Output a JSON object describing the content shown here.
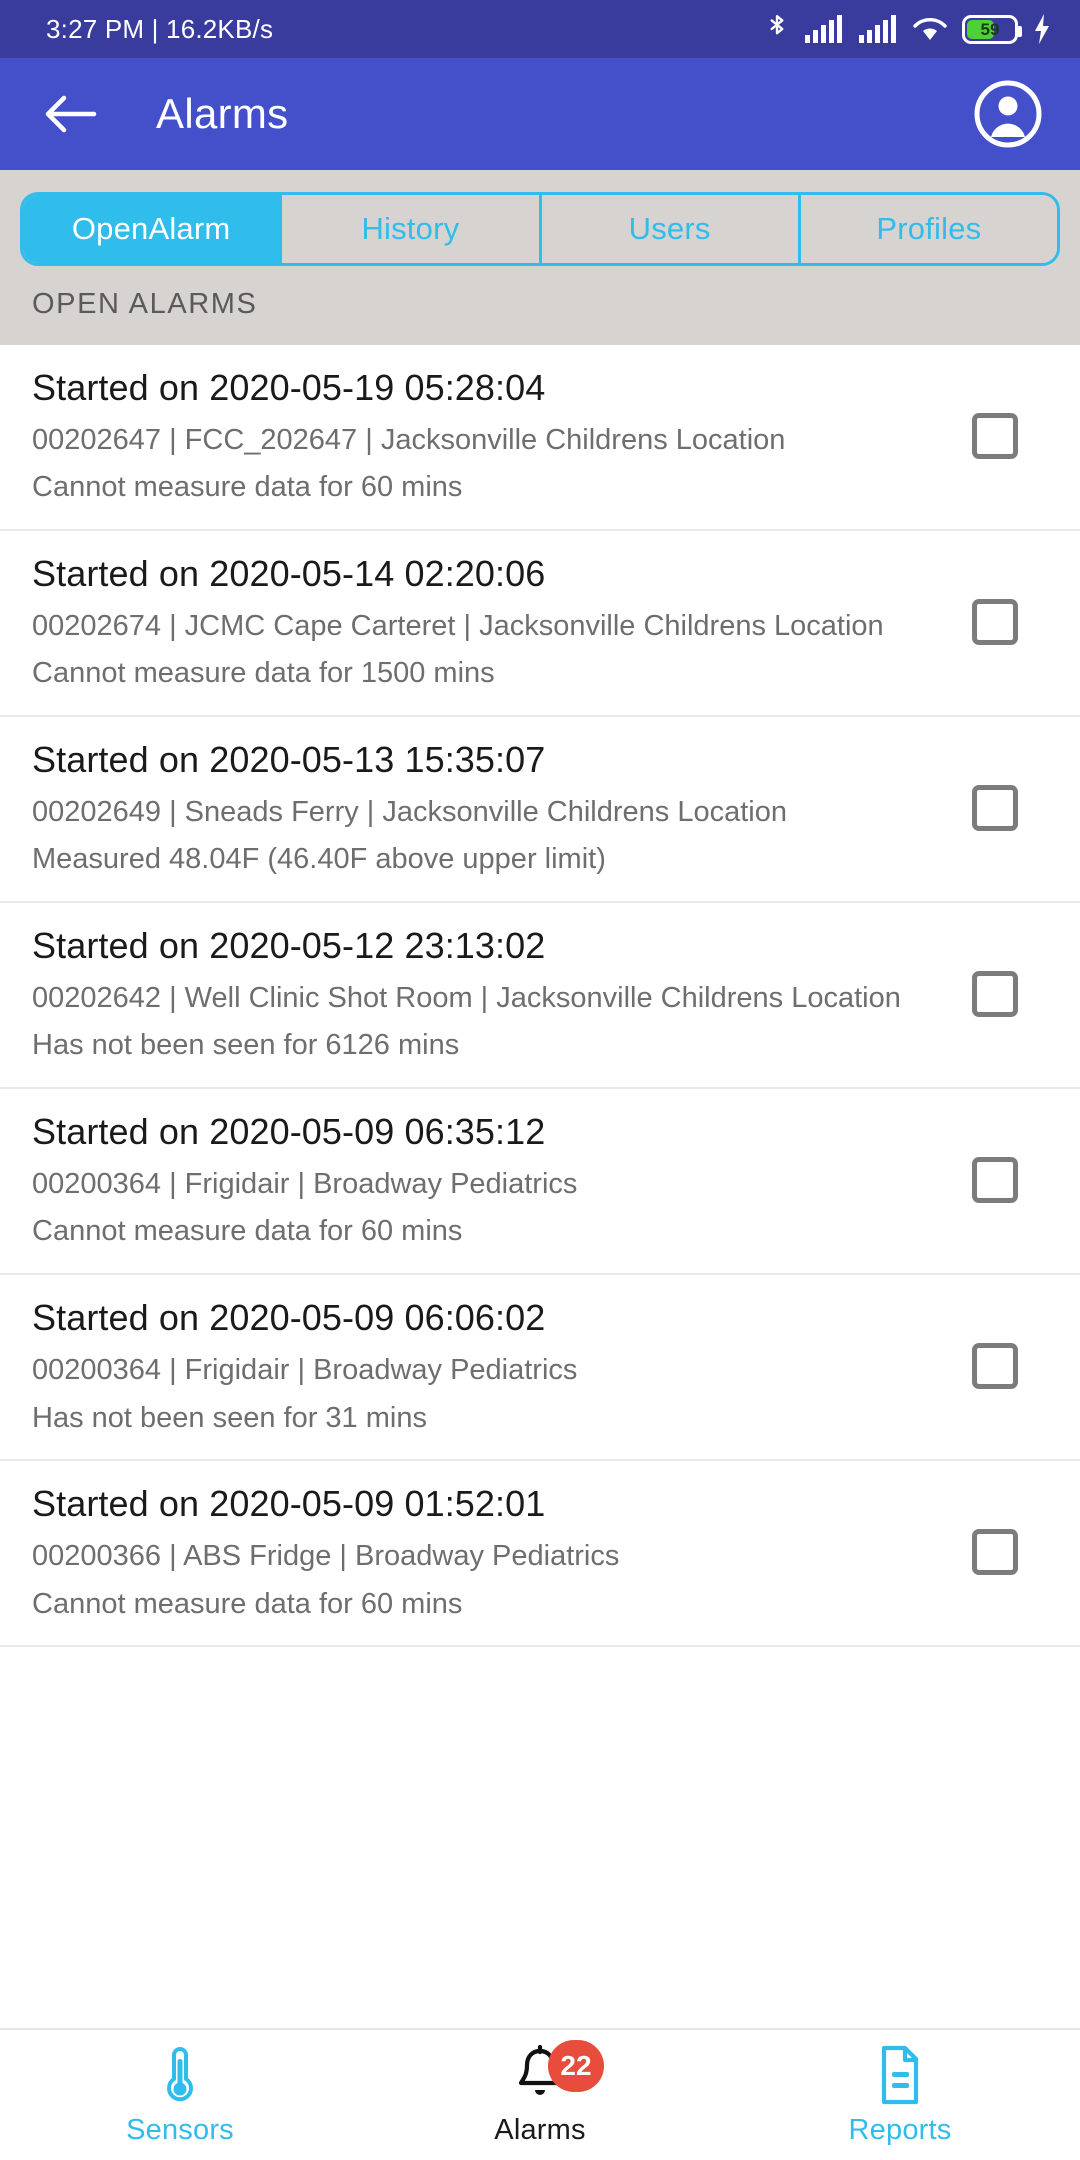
{
  "statusbar": {
    "time_and_speed": "3:27 PM | 16.2KB/s",
    "battery_percent": "59",
    "icons": [
      "bluetooth-icon",
      "signal-1-icon",
      "signal-2-icon",
      "wifi-icon",
      "battery-icon",
      "charging-bolt-icon"
    ]
  },
  "appbar": {
    "title": "Alarms",
    "back_icon": "back-arrow-icon",
    "account_icon": "account-circle-icon"
  },
  "tabs": [
    {
      "label": "OpenAlarm",
      "active": true
    },
    {
      "label": "History",
      "active": false
    },
    {
      "label": "Users",
      "active": false
    },
    {
      "label": "Profiles",
      "active": false
    }
  ],
  "section": {
    "title": "OPEN ALARMS"
  },
  "alarms": [
    {
      "time": "Started on 2020-05-19 05:28:04",
      "meta": "00202647 | FCC_202647 | Jacksonville Childrens Location",
      "status": "Cannot measure data for 60 mins",
      "checked": false
    },
    {
      "time": "Started on 2020-05-14 02:20:06",
      "meta": "00202674 | JCMC Cape Carteret | Jacksonville Childrens Location",
      "status": "Cannot measure data for 1500 mins",
      "checked": false
    },
    {
      "time": "Started on 2020-05-13 15:35:07",
      "meta": "00202649 | Sneads Ferry | Jacksonville Childrens Location",
      "status": "Measured 48.04F (46.40F above upper limit)",
      "checked": false
    },
    {
      "time": "Started on 2020-05-12 23:13:02",
      "meta": "00202642 | Well Clinic Shot Room | Jacksonville Childrens Location",
      "status": "Has not been seen for 6126 mins",
      "checked": false
    },
    {
      "time": "Started on 2020-05-09 06:35:12",
      "meta": "00200364 | Frigidair | Broadway Pediatrics",
      "status": "Cannot measure data for 60 mins",
      "checked": false
    },
    {
      "time": "Started on 2020-05-09 06:06:02",
      "meta": "00200364 | Frigidair | Broadway Pediatrics",
      "status": "Has not been seen for 31 mins",
      "checked": false
    },
    {
      "time": "Started on 2020-05-09 01:52:01",
      "meta": "00200366 | ABS Fridge | Broadway Pediatrics",
      "status": "Cannot measure data for 60 mins",
      "checked": false
    }
  ],
  "bottomnav": [
    {
      "label": "Sensors",
      "icon": "thermometer-icon",
      "active": false,
      "badge": ""
    },
    {
      "label": "Alarms",
      "icon": "bell-icon",
      "active": true,
      "badge": "22"
    },
    {
      "label": "Reports",
      "icon": "document-icon",
      "active": false,
      "badge": ""
    }
  ],
  "colors": {
    "statusbar_bg": "#393c9c",
    "appbar_bg": "#4350ca",
    "accent_cyan": "#30bdec",
    "tabstrip_bg": "#d6d3d1",
    "badge_red": "#e74c3c",
    "battery_green": "#4cd137"
  }
}
